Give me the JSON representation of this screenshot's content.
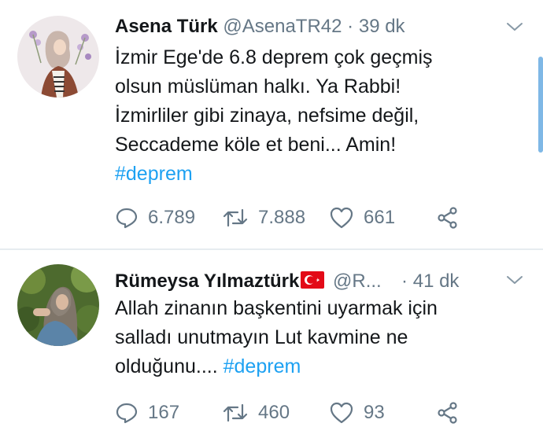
{
  "tweets": [
    {
      "name": "Asena Türk",
      "handle": "@AsenaTR42",
      "separator": "·",
      "time": "39 dk",
      "lines": [
        "İzmir Ege'de 6.8  deprem çok geçmiş",
        "olsun müslüman halkı. Ya Rabbi!",
        "İzmirliler gibi zinaya, nefsime değil,",
        "Seccademe köle et beni... Amin!"
      ],
      "hashtag": "#deprem",
      "replies": "6.789",
      "retweets": "7.888",
      "likes": "661"
    },
    {
      "name": "Rümeysa Yılmaztürk",
      "handle": "@R...",
      "separator": "·",
      "time": "41 dk",
      "lines": [
        "Allah zinanın başkentini uyarmak için",
        "salladı unutmayın Lut kavmine ne"
      ],
      "last_line_prefix": "olduğunu....",
      "hashtag": "#deprem",
      "replies": "167",
      "retweets": "460",
      "likes": "93"
    }
  ],
  "icons": {
    "reply": "reply-icon",
    "retweet": "retweet-icon",
    "like": "heart-icon",
    "share": "share-icon",
    "more": "chevron-down-icon",
    "flag": "turkey-flag-icon"
  },
  "colors": {
    "link": "#1da1f2",
    "muted": "#657786",
    "text": "#14171a",
    "divider": "#e6ecf0"
  }
}
